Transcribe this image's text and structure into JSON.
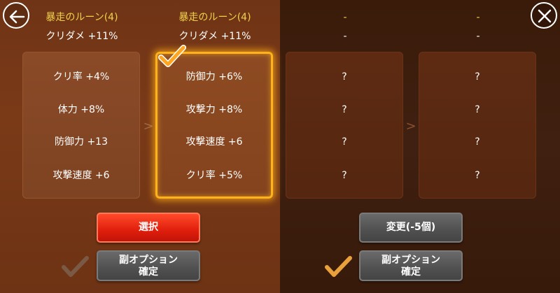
{
  "left_rune": {
    "name": "暴走のルーン(4)",
    "stat": "クリダメ +11%",
    "options": [
      "クリ率 +4%",
      "体力 +8%",
      "防御力 +13",
      "攻撃速度 +6"
    ]
  },
  "selected_rune": {
    "name": "暴走のルーン(4)",
    "stat": "クリダメ +11%",
    "options": [
      "防御力 +6%",
      "攻撃力 +8%",
      "攻撃速度 +6",
      "クリ率 +5%"
    ]
  },
  "right_rune_a": {
    "name": "-",
    "stat": "-",
    "options": [
      "?",
      "?",
      "?",
      "?"
    ]
  },
  "right_rune_b": {
    "name": "-",
    "stat": "-",
    "options": [
      "?",
      "?",
      "?",
      "?"
    ]
  },
  "arrow_glyph": ">",
  "buttons": {
    "select": "選択",
    "change": "変更(-5個)",
    "confirm_left_line1": "副オプション",
    "confirm_left_line2": "確定",
    "confirm_right_line1": "副オプション",
    "confirm_right_line2": "確定"
  },
  "colors": {
    "rune_name": "#f0d24a",
    "select_button": "#e8260f",
    "selected_border": "#ffb21a",
    "check": "#e9a13c"
  },
  "icons": [
    "back-arrow-icon",
    "close-icon",
    "checkmark-icon"
  ]
}
